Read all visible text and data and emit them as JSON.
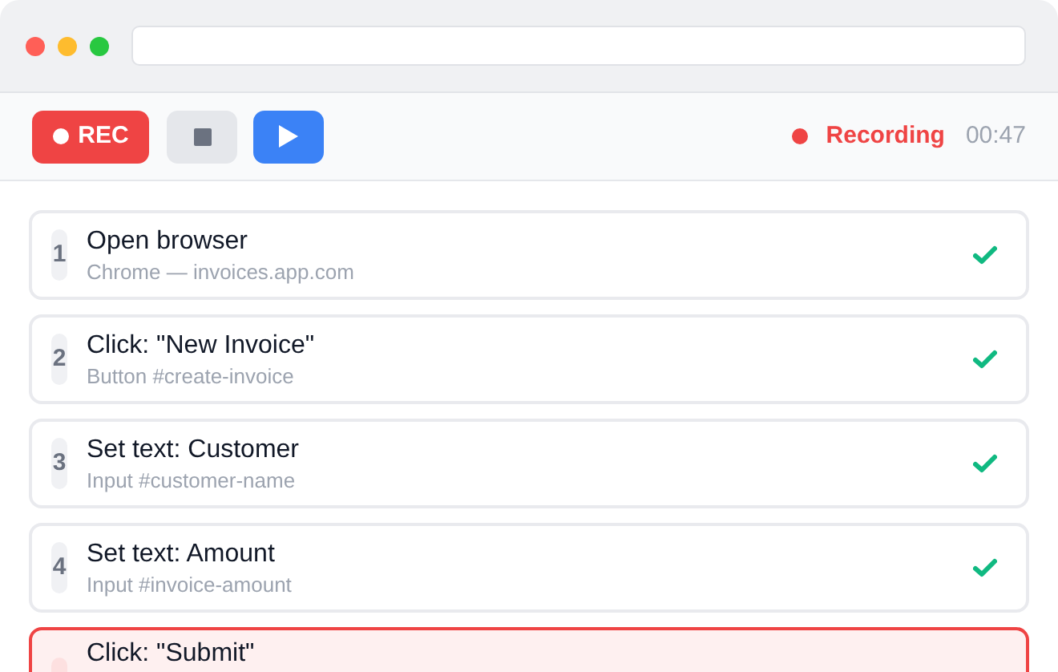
{
  "toolbar": {
    "record_button": "REC",
    "recording": true,
    "status": "Recording",
    "elapsed": "00:47"
  },
  "steps": [
    {
      "number": "1",
      "title": "Open browser",
      "detail": "Chrome — invoices.app.com",
      "kind": "done"
    },
    {
      "number": "2",
      "title": "Click: \"New Invoice\"",
      "detail": "Button #create-invoice",
      "kind": "done"
    },
    {
      "number": "3",
      "title": "Set text: Customer",
      "detail": "Input #customer-name",
      "kind": "done"
    },
    {
      "number": "4",
      "title": "Set text: Amount",
      "detail": "Input #invoice-amount",
      "kind": "done"
    },
    {
      "title": "Click: \"Submit\"",
      "kind": "capturing"
    }
  ]
}
